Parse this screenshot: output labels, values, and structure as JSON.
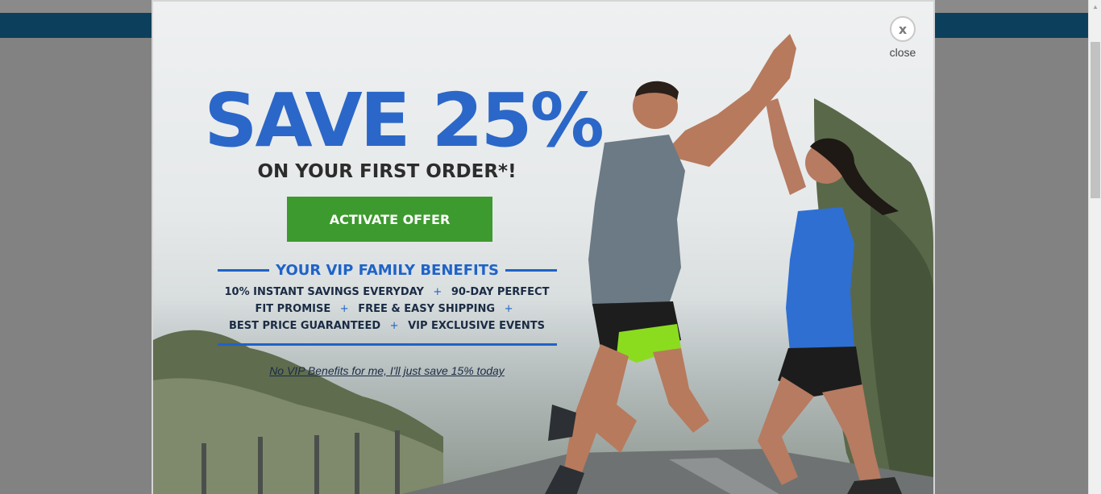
{
  "modal": {
    "close_icon": "x",
    "close_label": "close",
    "headline": "SAVE 25%",
    "subheadline": "ON YOUR FIRST ORDER*!",
    "cta_label": "ACTIVATE OFFER",
    "benefits_title": "YOUR VIP FAMILY BENEFITS",
    "benefit_lines": [
      [
        "10% INSTANT SAVINGS EVERYDAY",
        "90-DAY PERFECT"
      ],
      [
        "FIT PROMISE",
        "FREE & EASY SHIPPING"
      ],
      [
        "BEST PRICE GUARANTEED",
        "VIP EXCLUSIVE EVENTS"
      ]
    ],
    "separator": "+",
    "decline_link": "No VIP Benefits for me, I'll just save 15% today"
  },
  "colors": {
    "headline_blue": "#2b67c8",
    "cta_green": "#3d9a2e",
    "page_header_blue": "#0c3f5c"
  }
}
